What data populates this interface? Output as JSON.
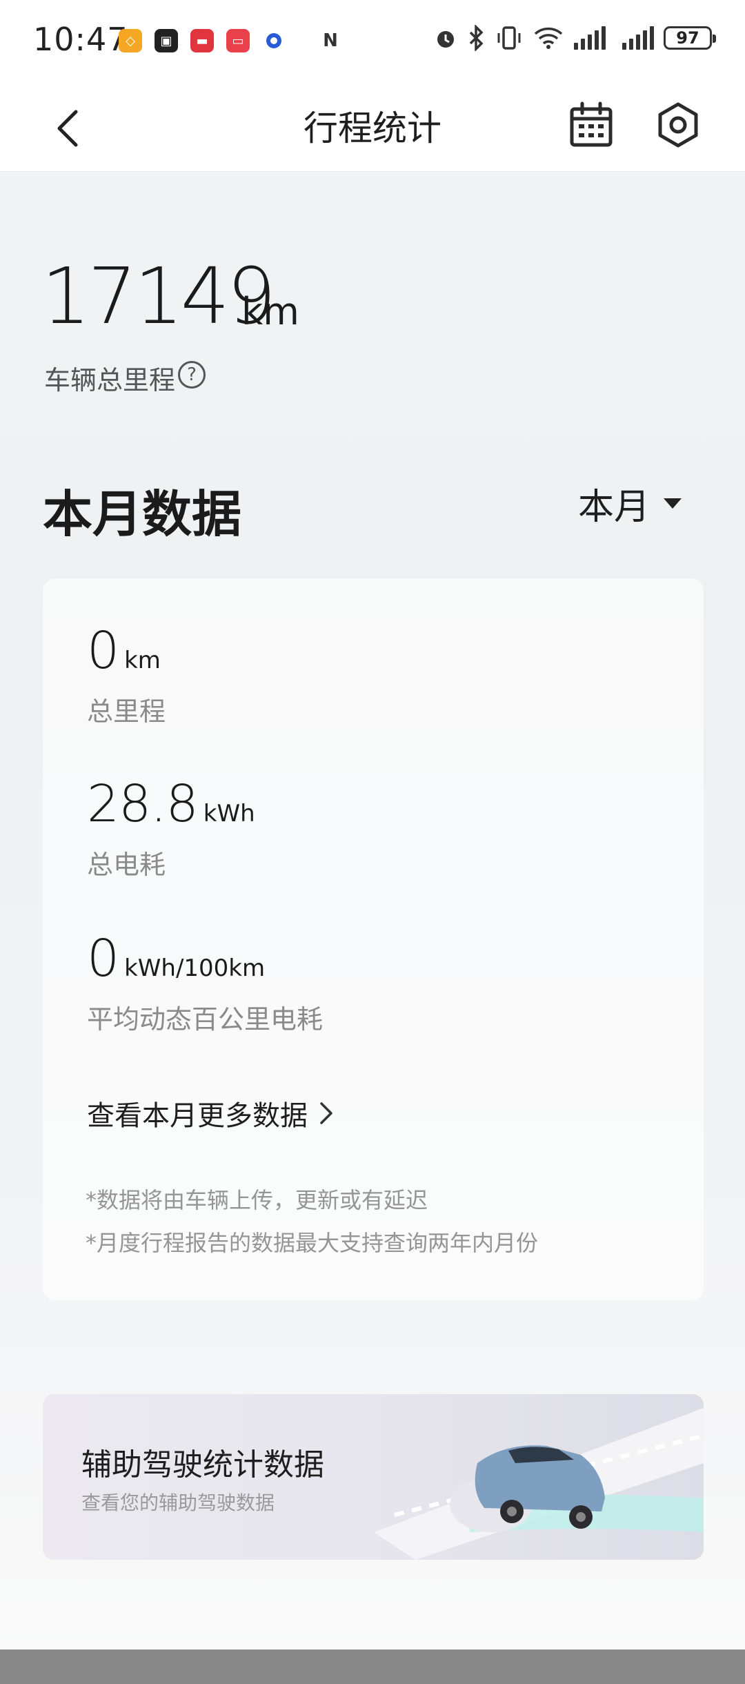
{
  "status_bar": {
    "time": "10:47",
    "battery": "97"
  },
  "header": {
    "title": "行程统计"
  },
  "total": {
    "value": "17149",
    "unit": "km",
    "label": "车辆总里程",
    "help_symbol": "?"
  },
  "month": {
    "section_title": "本月数据",
    "period": "本月",
    "metrics": [
      {
        "value": "0",
        "unit": "km",
        "label": "总里程"
      },
      {
        "value": "28.8",
        "unit": "kWh",
        "label": "总电耗"
      },
      {
        "value": "0",
        "unit": "kWh/100km",
        "label": "平均动态百公里电耗"
      }
    ],
    "more_link": "查看本月更多数据",
    "notes": [
      "*数据将由车辆上传，更新或有延迟",
      "*月度行程报告的数据最大支持查询两年内月份"
    ]
  },
  "banner": {
    "title": "辅助驾驶统计数据",
    "subtitle": "查看您的辅助驾驶数据"
  },
  "colors": {
    "accent_teal": "#7fd6d0",
    "car_blue": "#7f9fc0",
    "text_primary": "#1b1b1b",
    "text_muted": "#8a8a8a"
  },
  "icons": {
    "back": "chevron-left-icon",
    "calendar": "calendar-icon",
    "settings": "hexagon-settings-icon",
    "help": "question-circle-icon",
    "more": "chevron-right-icon",
    "dropdown": "caret-down-icon"
  }
}
